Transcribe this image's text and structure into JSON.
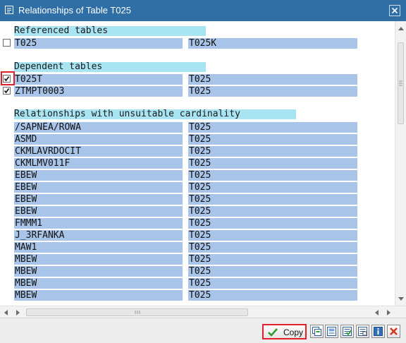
{
  "window": {
    "title": "Relationships of Table T025"
  },
  "sections": {
    "referenced": {
      "title": "Referenced tables",
      "rows": [
        {
          "col1": "T025",
          "col2": "T025K",
          "checked": false
        }
      ]
    },
    "dependent": {
      "title": "Dependent tables",
      "rows": [
        {
          "col1": "T025T",
          "col2": "T025",
          "checked": true
        },
        {
          "col1": "ZTMPT0003",
          "col2": "T025",
          "checked": true
        }
      ]
    },
    "unsuitable": {
      "title": "Relationships with unsuitable cardinality",
      "rows": [
        {
          "col1": "/SAPNEA/ROWA",
          "col2": "T025"
        },
        {
          "col1": "ASMD",
          "col2": "T025"
        },
        {
          "col1": "CKMLAVRDOCIT",
          "col2": "T025"
        },
        {
          "col1": "CKMLMV011F",
          "col2": "T025"
        },
        {
          "col1": "EBEW",
          "col2": "T025"
        },
        {
          "col1": "EBEW",
          "col2": "T025"
        },
        {
          "col1": "EBEW",
          "col2": "T025"
        },
        {
          "col1": "EBEW",
          "col2": "T025"
        },
        {
          "col1": "FMMM1",
          "col2": "T025"
        },
        {
          "col1": "J_3RFANKA",
          "col2": "T025"
        },
        {
          "col1": "MAW1",
          "col2": "T025"
        },
        {
          "col1": "MBEW",
          "col2": "T025"
        },
        {
          "col1": "MBEW",
          "col2": "T025"
        },
        {
          "col1": "MBEW",
          "col2": "T025"
        },
        {
          "col1": "MBEW",
          "col2": "T025"
        }
      ]
    }
  },
  "footer": {
    "copy_label": "Copy",
    "tools": [
      "copy-rows-icon",
      "display-icon",
      "select-all-icon",
      "deselect-all-icon",
      "information-icon",
      "cancel-icon"
    ]
  },
  "colors": {
    "title_bar": "#2f6fa6",
    "section_header": "#a8e4f2",
    "cell": "#a8c4e8",
    "highlight": "#e0202a",
    "check_green": "#2e9b2e"
  }
}
